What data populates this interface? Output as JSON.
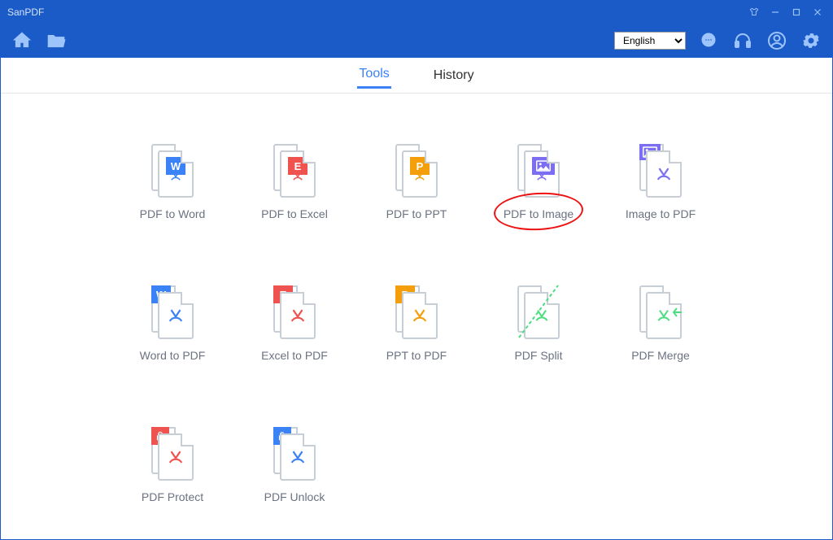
{
  "app": {
    "title": "SanPDF"
  },
  "toolbar": {
    "language": "English"
  },
  "tabs": {
    "tools": "Tools",
    "history": "History",
    "active": "tools"
  },
  "tools": {
    "r0c0": "PDF to Word",
    "r0c1": "PDF to Excel",
    "r0c2": "PDF to PPT",
    "r0c3": "PDF to Image",
    "r0c4": "Image to PDF",
    "r1c0": "Word to PDF",
    "r1c1": "Excel to PDF",
    "r1c2": "PPT to PDF",
    "r1c3": "PDF Split",
    "r1c4": "PDF Merge",
    "r2c0": "PDF Protect",
    "r2c1": "PDF Unlock"
  },
  "highlighted_tool": "r0c3"
}
